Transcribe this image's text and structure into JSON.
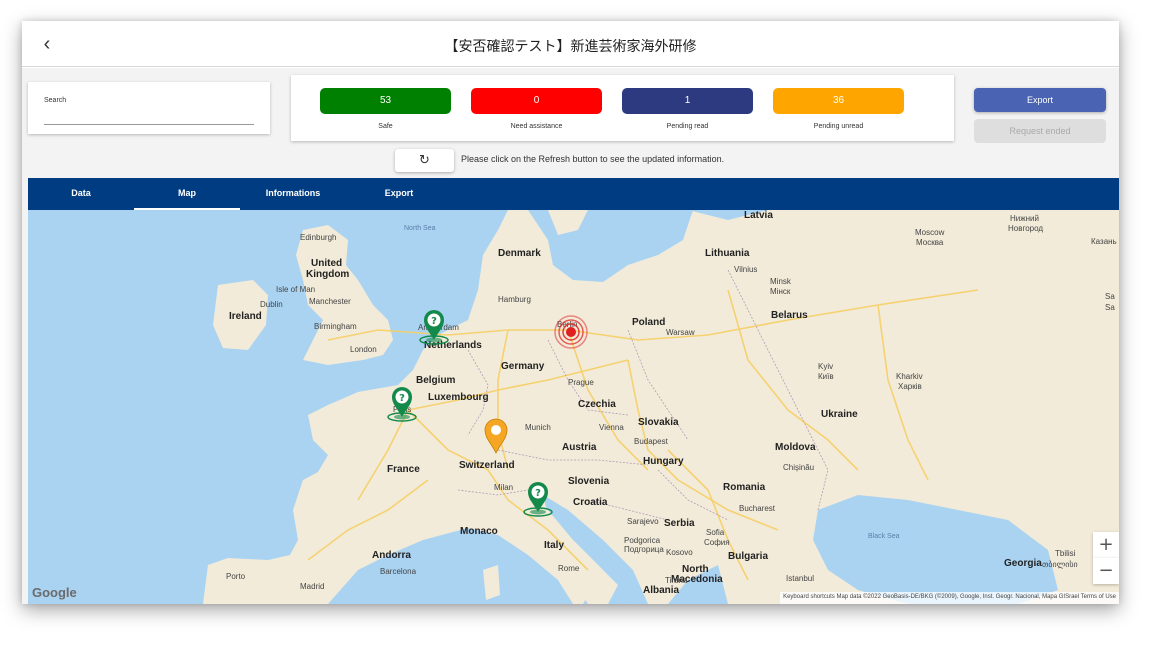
{
  "header": {
    "title": "【安否確認テスト】新進芸術家海外研修",
    "back_icon": "chevron-left-icon"
  },
  "search": {
    "label": "Search",
    "value": ""
  },
  "stats": [
    {
      "key": "safe",
      "count": "53",
      "label": "Safe",
      "color": "#008000"
    },
    {
      "key": "need",
      "count": "0",
      "label": "Need assistance",
      "color": "#ff0000"
    },
    {
      "key": "pending_read",
      "count": "1",
      "label": "Pending read",
      "color": "#2e3a80"
    },
    {
      "key": "pending_unread",
      "count": "36",
      "label": "Pending unread",
      "color": "#ffa500"
    }
  ],
  "actions": {
    "export_label": "Export",
    "request_ended_label": "Request ended"
  },
  "refresh": {
    "icon": "refresh-icon",
    "note": "Please click on the Refresh button to see the updated information."
  },
  "tabs": [
    {
      "label": "Data",
      "active": false
    },
    {
      "label": "Map",
      "active": true
    },
    {
      "label": "Informations",
      "active": false
    },
    {
      "label": "Export",
      "active": false
    }
  ],
  "map": {
    "labels": {
      "latvia": "Latvia",
      "north_sea": "North Sea",
      "nizhny": "Нижний",
      "novgorod": "Новгород",
      "edinburgh": "Edinburgh",
      "denmark": "Denmark",
      "moscow": "Moscow",
      "moskva": "Москва",
      "kazan": "Казань",
      "united": "United",
      "kingdom": "Kingdom",
      "lithuania": "Lithuania",
      "vilnius": "Vilnius",
      "isle_of_man": "Isle of Man",
      "minsk": "Minsk",
      "minsk_cyr": "Мінск",
      "dublin": "Dublin",
      "manchester": "Manchester",
      "hamburg": "Hamburg",
      "ireland": "Ireland",
      "amsterdam": "Amsterdam",
      "berlin": "Berlin",
      "belarus": "Belarus",
      "birmingham": "Birmingham",
      "poland": "Poland",
      "warsaw": "Warsaw",
      "netherlands": "Netherlands",
      "london": "London",
      "germany": "Germany",
      "kyiv": "Kyiv",
      "kyiv_cyr": "Київ",
      "kharkiv": "Kharkiv",
      "kharkiv_cyr": "Харків",
      "belgium": "Belgium",
      "prague": "Prague",
      "luxembourg": "Luxembourg",
      "czechia": "Czechia",
      "ukraine": "Ukraine",
      "slovakia": "Slovakia",
      "paris": "Paris",
      "munich": "Munich",
      "vienna": "Vienna",
      "budapest": "Budapest",
      "austria": "Austria",
      "moldova": "Moldova",
      "chisinau": "Chișinău",
      "france": "France",
      "switzerland": "Switzerland",
      "hungary": "Hungary",
      "milan": "Milan",
      "slovenia": "Slovenia",
      "romania": "Romania",
      "croatia": "Croatia",
      "bucharest": "Bucharest",
      "sarajevo": "Sarajevo",
      "serbia": "Serbia",
      "monaco": "Monaco",
      "podgorica": "Podgorica",
      "podgorica_cyr": "Подгорица",
      "sofia": "Sofia",
      "sofia_cyr": "София",
      "black_sea": "Black Sea",
      "andorra": "Andorra",
      "italy": "Italy",
      "kosovo": "Kosovo",
      "bulgaria": "Bulgaria",
      "tbilisi": "Tbilisi",
      "tbilisi_geo": "თბილისი",
      "barcelona": "Barcelona",
      "north": "North",
      "macedonia": "Macedonia",
      "georgia": "Georgia",
      "rome": "Rome",
      "porto": "Porto",
      "madrid": "Madrid",
      "tirana": "Tirana",
      "istanbul": "Istanbul",
      "albania": "Albania",
      "sa_partial": "Sa",
      "sa_partial2": "Sa"
    },
    "zoom_in": "+",
    "zoom_out": "−",
    "google": "Google",
    "attribution": "Keyboard shortcuts   Map data ©2022 GeoBasis-DE/BKG (©2009), Google, Inst. Geogr. Nacional, Mapa GISrael   Terms of Use",
    "marker_icons": [
      "question-pin-icon",
      "question-pin-icon",
      "pending-pin-icon",
      "question-pin-icon",
      "alert-pulse-icon"
    ],
    "colors": {
      "land": "#f2ebd9",
      "water": "#aad3f2",
      "safe_marker": "#138a4a",
      "pending_marker": "#f5a623",
      "alert": "#e02020"
    }
  }
}
